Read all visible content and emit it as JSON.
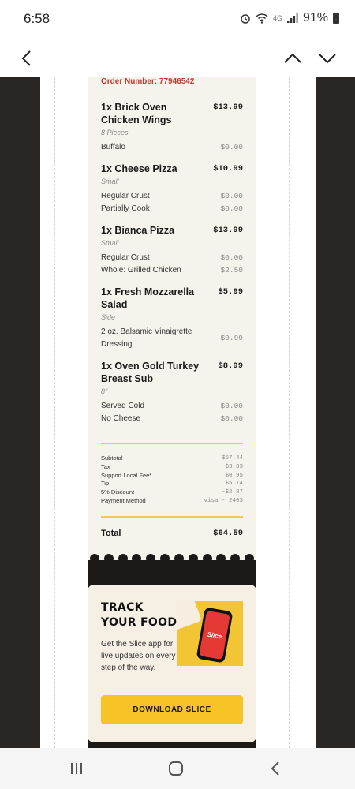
{
  "status_bar": {
    "time": "6:58",
    "network": "4G",
    "battery": "91%"
  },
  "receipt": {
    "order_number": "Order Number: 77946542",
    "items": [
      {
        "name": "1x Brick Oven Chicken Wings",
        "price": "$13.99",
        "sub": "8 Pieces",
        "options": [
          {
            "label": "Buffalo",
            "price": "$0.00"
          }
        ]
      },
      {
        "name": "1x Cheese Pizza",
        "price": "$10.99",
        "sub": "Small",
        "options": [
          {
            "label": "Regular Crust",
            "price": "$0.00"
          },
          {
            "label": "Partially Cook",
            "price": "$0.00"
          }
        ]
      },
      {
        "name": "1x Bianca Pizza",
        "price": "$13.99",
        "sub": "Small",
        "options": [
          {
            "label": "Regular Crust",
            "price": "$0.00"
          },
          {
            "label": "Whole: Grilled Chicken",
            "price": "$2.50"
          }
        ]
      },
      {
        "name": "1x Fresh Mozzarella Salad",
        "price": "$5.99",
        "sub": "Side",
        "options": [
          {
            "label": "2 oz. Balsamic Vinaigrette Dressing",
            "price": "$0.99"
          }
        ]
      },
      {
        "name": "1x Oven Gold Turkey Breast Sub",
        "price": "$8.99",
        "sub": "8\"",
        "options": [
          {
            "label": "Served Cold",
            "price": "$0.00"
          },
          {
            "label": "No Cheese",
            "price": "$0.00"
          }
        ]
      }
    ],
    "summary": [
      {
        "label": "Subtotal",
        "value": "$57.44"
      },
      {
        "label": "Tax",
        "value": "$3.33"
      },
      {
        "label": "Support Local Fee*",
        "value": "$0.95"
      },
      {
        "label": "Tip",
        "value": "$5.74"
      },
      {
        "label": "5% Discount",
        "value": "-$2.87"
      },
      {
        "label": "Payment Method",
        "value": "visa - 2403"
      }
    ],
    "total_label": "Total",
    "total_value": "$64.59"
  },
  "promo": {
    "title_line1": "TRACK",
    "title_line2": "YOUR FOOD",
    "text": "Get the Slice app for live updates on every step of the way.",
    "phone_logo": "Slice",
    "button_label": "DOWNLOAD SLICE"
  },
  "colors": {
    "accent_gold": "#f6c426",
    "order_red": "#c0392b",
    "background_dark": "#2a2624"
  }
}
